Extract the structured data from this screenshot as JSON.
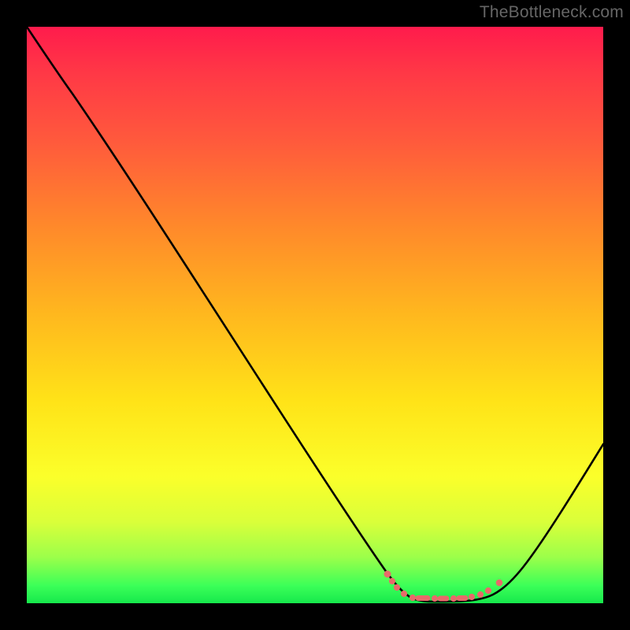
{
  "watermark": "TheBottleneck.com",
  "chart_data": {
    "type": "line",
    "title": "",
    "xlabel": "",
    "ylabel": "",
    "xlim": [
      0,
      100
    ],
    "ylim": [
      0,
      100
    ],
    "series": [
      {
        "name": "bottleneck-curve",
        "x": [
          0,
          5,
          10,
          15,
          20,
          25,
          30,
          35,
          40,
          45,
          50,
          55,
          60,
          62,
          64,
          66,
          68,
          70,
          72,
          74,
          76,
          78,
          80,
          82,
          85,
          90,
          95,
          100
        ],
        "y": [
          100,
          95,
          89,
          82,
          73,
          64,
          55,
          46,
          37,
          28,
          19,
          12,
          6,
          4,
          3,
          2,
          1.5,
          1,
          1,
          1,
          1,
          1.5,
          2,
          3,
          5,
          12,
          21,
          31
        ]
      }
    ],
    "annotations": [
      {
        "name": "optimal-region-dots",
        "x_start": 62,
        "x_end": 80,
        "y": 1
      }
    ],
    "colors": {
      "curve": "#000000",
      "dots": "#e86a6a",
      "background_top": "#ff1b4c",
      "background_bottom": "#16e84c"
    }
  }
}
